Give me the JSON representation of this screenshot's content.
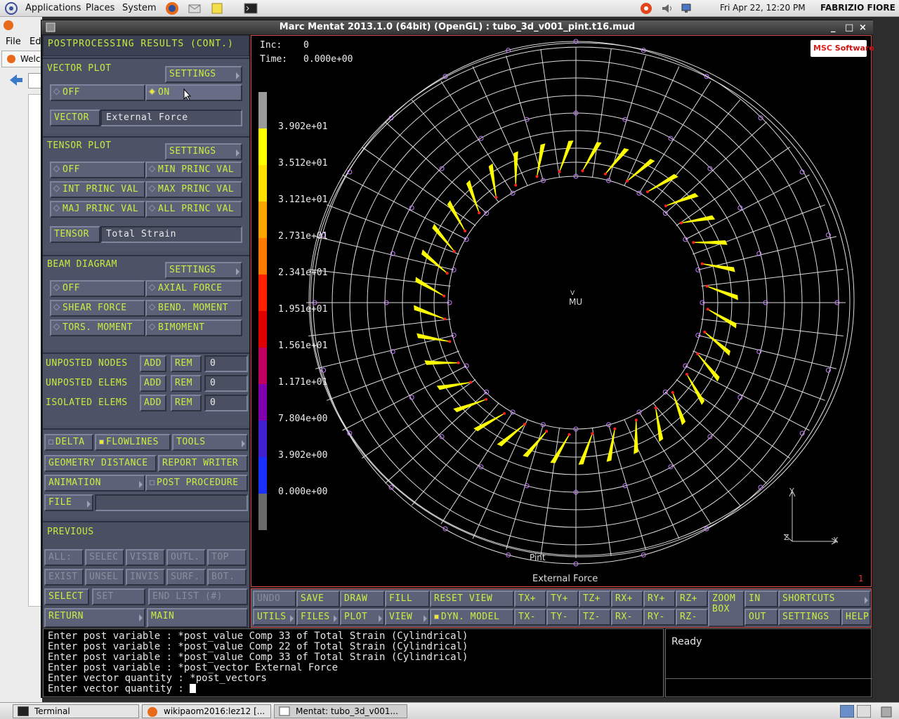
{
  "topbar": {
    "applications": "Applications",
    "places": "Places",
    "system": "System",
    "datetime": "Fri Apr 22, 12:20 PM",
    "user": "FABRIZIO FIORE"
  },
  "bg_window": {
    "file": "File",
    "edit": "Ed",
    "tab": "Welc"
  },
  "window": {
    "title": "Marc Mentat 2013.1.0 (64bit) (OpenGL) : tubo_3d_v001_pint.t16.mud",
    "min": "_",
    "max": "□",
    "close": "×"
  },
  "panel": {
    "header": "POSTPROCESSING RESULTS (CONT.)",
    "vector": {
      "title": "VECTOR PLOT",
      "settings": "SETTINGS",
      "off": "OFF",
      "on": "ON",
      "vector_label": "VECTOR",
      "vector_value": "External Force"
    },
    "tensor": {
      "title": "TENSOR PLOT",
      "settings": "SETTINGS",
      "off": "OFF",
      "min": "MIN PRINC VAL",
      "int": "INT PRINC VAL",
      "max": "MAX PRINC VAL",
      "maj": "MAJ PRINC VAL",
      "all": "ALL PRINC VAL",
      "tensor_label": "TENSOR",
      "tensor_value": "Total Strain"
    },
    "beam": {
      "title": "BEAM DIAGRAM",
      "settings": "SETTINGS",
      "off": "OFF",
      "axial": "AXIAL FORCE",
      "shear": "SHEAR FORCE",
      "bend": "BEND. MOMENT",
      "tors": "TORS. MOMENT",
      "bimoment": "BIMOMENT"
    },
    "unposted": {
      "nodes": "UNPOSTED NODES",
      "elems": "UNPOSTED ELEMS",
      "isolated": "ISOLATED ELEMS",
      "add": "ADD",
      "rem": "REM",
      "nodes_val": "0",
      "elems_val": "0",
      "isolated_val": "0"
    },
    "delta": "DELTA",
    "flowlines": "FLOWLINES",
    "tools": "TOOLS",
    "geometry_distance": "GEOMETRY DISTANCE",
    "report_writer": "REPORT WRITER",
    "animation": "ANIMATION",
    "post_procedure": "POST PROCEDURE",
    "file": "FILE",
    "previous": "PREVIOUS",
    "sel_row1": [
      "ALL:",
      "SELEC",
      "VISIB",
      "OUTL.",
      "TOP"
    ],
    "sel_row2": [
      "EXIST",
      "UNSEL",
      "INVIS",
      "SURF.",
      "BOT."
    ],
    "select": "SELECT",
    "set": "SET",
    "end_list": "END LIST (#)",
    "return": "RETURN",
    "main": "MAIN"
  },
  "viewport": {
    "inc_label": "Inc:",
    "inc_value": "0",
    "time_label": "Time:",
    "time_value": "0.000e+00",
    "logo_a": "MSC",
    "logo_b": "Software",
    "center": "MU",
    "v_mark": "V",
    "label_pint": "Pint",
    "label_ext": "External Force",
    "corner": "1",
    "axis_x": "X",
    "axis_y": "Y",
    "axis_z": "Z"
  },
  "legend": {
    "labels": [
      "3.902e+01",
      "3.512e+01",
      "3.121e+01",
      "2.731e+01",
      "2.341e+01",
      "1.951e+01",
      "1.561e+01",
      "1.171e+01",
      "7.804e+00",
      "3.902e+00",
      "0.000e+00"
    ],
    "colors": [
      "#9a9a9a",
      "#ffff00",
      "#ffe000",
      "#ffa500",
      "#ff7a00",
      "#ff2000",
      "#e00000",
      "#c00060",
      "#8000b0",
      "#4020d0",
      "#1a30ff",
      "#6a6a6a"
    ]
  },
  "cmd": {
    "undo": "UNDO",
    "save": "SAVE",
    "draw": "DRAW",
    "fill": "FILL",
    "reset_view": "RESET VIEW",
    "txp": "TX+",
    "typ": "TY+",
    "tzp": "TZ+",
    "rxp": "RX+",
    "ryp": "RY+",
    "rzp": "RZ+",
    "zoom": "ZOOM",
    "box": "BOX",
    "in": "IN",
    "shortcuts": "SHORTCUTS",
    "utils": "UTILS",
    "files": "FILES",
    "plot": "PLOT",
    "view": "VIEW",
    "dyn_model": "DYN. MODEL",
    "txm": "TX-",
    "tym": "TY-",
    "tzm": "TZ-",
    "rxm": "RX-",
    "rym": "RY-",
    "rzm": "RZ-",
    "out": "OUT",
    "settings": "SETTINGS",
    "help": "HELP"
  },
  "console": {
    "lines": [
      "Enter post variable : *post_value Comp 33 of Total Strain (Cylindrical)",
      "Enter post variable : *post_value Comp 22 of Total Strain (Cylindrical)",
      "Enter post variable : *post_value Comp 33 of Total Strain (Cylindrical)",
      "Enter post variable : *post_vector External Force",
      "Enter vector quantity : *post_vectors",
      "Enter vector quantity : "
    ]
  },
  "status": "Ready",
  "taskbar": {
    "terminal": "Terminal",
    "browser": "wikipaom2016:lez12 [...",
    "mentat": "Mentat: tubo_3d_v001..."
  }
}
